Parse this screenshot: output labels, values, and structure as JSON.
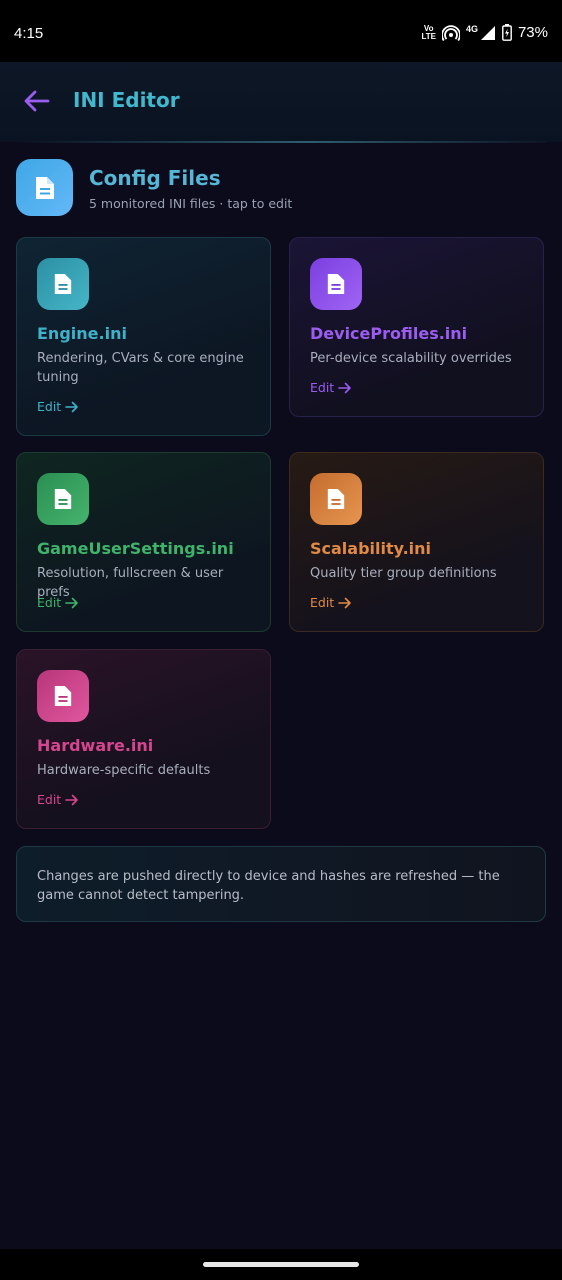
{
  "status_bar": {
    "time": "4:15",
    "volte_top": "Vo",
    "volte_bottom": "LTE",
    "network": "4G",
    "battery": "73%"
  },
  "app_bar": {
    "title": "INI Editor",
    "back_icon": "arrow-left-icon"
  },
  "header": {
    "icon": "document-icon",
    "title": "Config Files",
    "subtitle": "5 monitored INI files · tap to edit"
  },
  "files": [
    {
      "name": "Engine.ini",
      "description": "Rendering, CVars & core engine tuning",
      "edit_label": "Edit",
      "accent": "#3fb2c9"
    },
    {
      "name": "DeviceProfiles.ini",
      "description": "Per-device scalability overrides",
      "edit_label": "Edit",
      "accent": "#9b5cf0"
    },
    {
      "name": "GameUserSettings.ini",
      "description": "Resolution, fullscreen & user prefs",
      "edit_label": "Edit",
      "accent": "#3fb36a"
    },
    {
      "name": "Scalability.ini",
      "description": "Quality tier group definitions",
      "edit_label": "Edit",
      "accent": "#e08a45"
    },
    {
      "name": "Hardware.ini",
      "description": "Hardware-specific defaults",
      "edit_label": "Edit",
      "accent": "#d6458f"
    }
  ],
  "notice": "Changes are pushed directly to device and hashes are refreshed — the game cannot detect tampering."
}
